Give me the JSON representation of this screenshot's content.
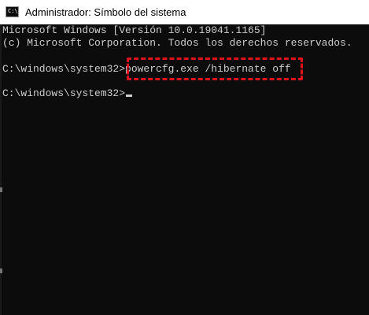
{
  "window": {
    "title": "Administrador: Símbolo del sistema",
    "icon": "cmd-icon",
    "icon_glyph": "C:\\_"
  },
  "console": {
    "lines": [
      "Microsoft Windows [Versión 10.0.19041.1165]",
      "(c) Microsoft Corporation. Todos los derechos reservados."
    ],
    "command_prompt": "C:\\windows\\system32>",
    "command": "powercfg.exe /hibernate off",
    "current_prompt": "C:\\windows\\system32>"
  },
  "colors": {
    "console_background": "#0c0c0c",
    "console_text": "#cccccc",
    "highlight_border": "#e0121c"
  }
}
